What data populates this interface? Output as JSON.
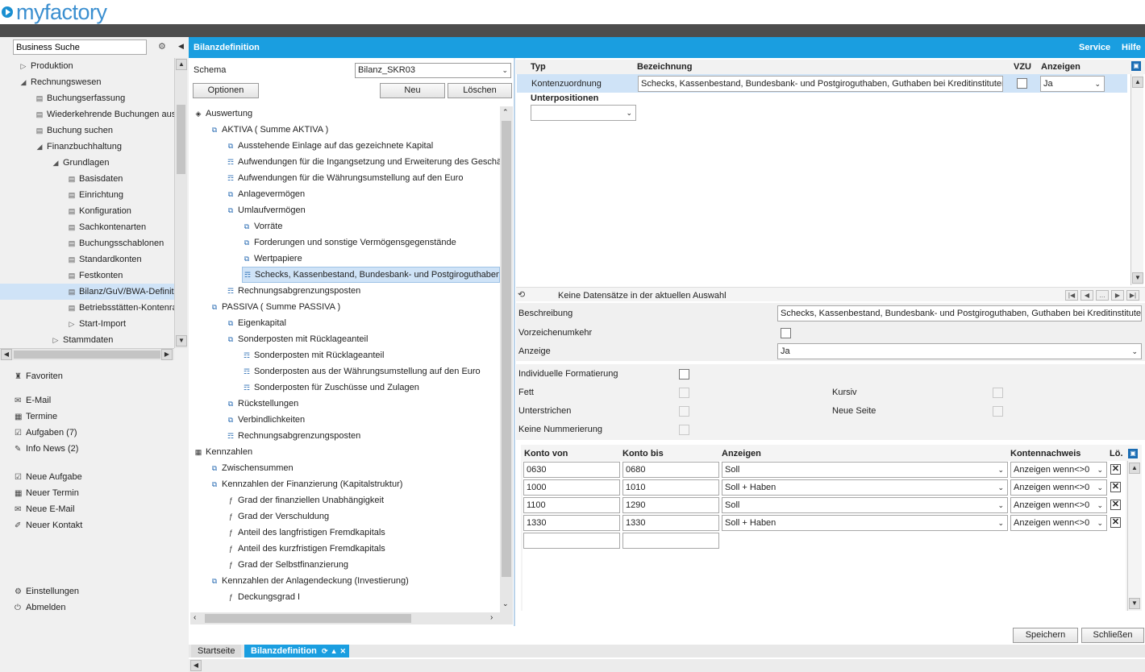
{
  "app": {
    "logo": "myfactory"
  },
  "sidebar": {
    "search_value": "Business Suche",
    "tree": [
      {
        "label": "Produktion",
        "icon": "expand-icon"
      },
      {
        "label": "Rechnungswesen",
        "icon": "collapse-icon"
      },
      {
        "label": "Buchungserfassung",
        "icon": "page-icon"
      },
      {
        "label": "Wiederkehrende Buchungen aus",
        "icon": "page-icon"
      },
      {
        "label": "Buchung suchen",
        "icon": "page-icon"
      },
      {
        "label": "Finanzbuchhaltung",
        "icon": "collapse-icon"
      },
      {
        "label": "Grundlagen",
        "icon": "collapse-icon"
      },
      {
        "label": "Basisdaten",
        "icon": "page-icon"
      },
      {
        "label": "Einrichtung",
        "icon": "page-icon"
      },
      {
        "label": "Konfiguration",
        "icon": "page-icon"
      },
      {
        "label": "Sachkontenarten",
        "icon": "page-icon"
      },
      {
        "label": "Buchungsschablonen",
        "icon": "page-icon"
      },
      {
        "label": "Standardkonten",
        "icon": "page-icon"
      },
      {
        "label": "Festkonten",
        "icon": "page-icon"
      },
      {
        "label": "Bilanz/GuV/BWA-Definit",
        "icon": "page-icon"
      },
      {
        "label": "Betriebsstätten-Kontenra",
        "icon": "page-icon"
      },
      {
        "label": "Start-Import",
        "icon": "expand-icon"
      },
      {
        "label": "Stammdaten",
        "icon": "expand-icon"
      }
    ],
    "favorites": "Favoriten",
    "links1": [
      "E-Mail",
      "Termine",
      "Aufgaben (7)",
      "Info News (2)"
    ],
    "links2": [
      "Neue Aufgabe",
      "Neuer Termin",
      "Neue E-Mail",
      "Neuer Kontakt"
    ],
    "settings": "Einstellungen",
    "logout": "Abmelden"
  },
  "header": {
    "title": "Bilanzdefinition",
    "service": "Service",
    "help": "Hilfe"
  },
  "schema": {
    "label": "Schema",
    "value": "Bilanz_SKR03",
    "options_button": "Optionen",
    "new_button": "Neu",
    "delete_button": "Löschen"
  },
  "tree": [
    {
      "label": "Auswertung",
      "level": 0,
      "icon": "diamond-icon"
    },
    {
      "label": "AKTIVA ( Summe AKTIVA )",
      "level": 1,
      "icon": "node-icon"
    },
    {
      "label": "Ausstehende Einlage auf das gezeichnete Kapital",
      "level": 2,
      "icon": "node-icon"
    },
    {
      "label": "Aufwendungen für die Ingangsetzung und Erweiterung des Geschä",
      "level": 2,
      "icon": "account-icon"
    },
    {
      "label": "Aufwendungen für die Währungsumstellung auf den Euro",
      "level": 2,
      "icon": "account-icon"
    },
    {
      "label": "Anlagevermögen",
      "level": 2,
      "icon": "node-icon"
    },
    {
      "label": "Umlaufvermögen",
      "level": 2,
      "icon": "node-icon"
    },
    {
      "label": "Vorräte",
      "level": 3,
      "icon": "node-icon"
    },
    {
      "label": "Forderungen und sonstige Vermögensgegenstände",
      "level": 3,
      "icon": "node-icon"
    },
    {
      "label": "Wertpapiere",
      "level": 3,
      "icon": "node-icon"
    },
    {
      "label": "Schecks, Kassenbestand, Bundesbank- und Postgiroguthaben,",
      "level": 3,
      "icon": "account-icon",
      "selected": true
    },
    {
      "label": "Rechnungsabgrenzungsposten",
      "level": 2,
      "icon": "account-icon"
    },
    {
      "label": "PASSIVA ( Summe PASSIVA )",
      "level": 1,
      "icon": "node-icon"
    },
    {
      "label": "Eigenkapital",
      "level": 2,
      "icon": "node-icon"
    },
    {
      "label": "Sonderposten mit Rücklageanteil",
      "level": 2,
      "icon": "node-icon"
    },
    {
      "label": "Sonderposten mit Rücklageanteil",
      "level": 3,
      "icon": "account-icon"
    },
    {
      "label": "Sonderposten aus der Währungsumstellung auf den Euro",
      "level": 3,
      "icon": "account-icon"
    },
    {
      "label": "Sonderposten für Zuschüsse und Zulagen",
      "level": 3,
      "icon": "account-icon"
    },
    {
      "label": "Rückstellungen",
      "level": 2,
      "icon": "node-icon"
    },
    {
      "label": "Verbindlichkeiten",
      "level": 2,
      "icon": "node-icon"
    },
    {
      "label": "Rechnungsabgrenzungsposten",
      "level": 2,
      "icon": "account-icon"
    },
    {
      "label": "Kennzahlen",
      "level": 0,
      "icon": "calculator-icon"
    },
    {
      "label": "Zwischensummen",
      "level": 1,
      "icon": "node-icon"
    },
    {
      "label": "Kennzahlen der Finanzierung (Kapitalstruktur)",
      "level": 1,
      "icon": "node-icon"
    },
    {
      "label": "Grad der finanziellen Unabhängigkeit",
      "level": 2,
      "icon": "formula-icon"
    },
    {
      "label": "Grad der Verschuldung",
      "level": 2,
      "icon": "formula-icon"
    },
    {
      "label": "Anteil des langfristigen Fremdkapitals",
      "level": 2,
      "icon": "formula-icon"
    },
    {
      "label": "Anteil des kurzfristigen Fremdkapitals",
      "level": 2,
      "icon": "formula-icon"
    },
    {
      "label": "Grad der Selbstfinanzierung",
      "level": 2,
      "icon": "formula-icon"
    },
    {
      "label": "Kennzahlen der Anlagendeckung (Investierung)",
      "level": 1,
      "icon": "node-icon"
    },
    {
      "label": "Deckungsgrad I",
      "level": 2,
      "icon": "formula-icon"
    }
  ],
  "grid": {
    "headers": {
      "typ": "Typ",
      "bezeichnung": "Bezeichnung",
      "vzu": "VZU",
      "anzeigen": "Anzeigen"
    },
    "row": {
      "typ": "Kontenzuordnung",
      "bezeichnung": "Schecks, Kassenbestand, Bundesbank- und Postgiroguthaben, Guthaben bei Kreditinstituten",
      "anzeigen": "Ja"
    },
    "subheader": "Unterpositionen",
    "sub_value": "",
    "status": "Keine Datensätze in der aktuellen Auswahl"
  },
  "form": {
    "beschreibung_label": "Beschreibung",
    "beschreibung_value": "Schecks, Kassenbestand, Bundesbank- und Postgiroguthaben, Guthaben bei Kreditinstituten",
    "vorzeichen_label": "Vorzeichenumkehr",
    "anzeige_label": "Anzeige",
    "anzeige_value": "Ja",
    "indiv_label": "Individuelle Formatierung",
    "fett_label": "Fett",
    "kursiv_label": "Kursiv",
    "unterstrichen_label": "Unterstrichen",
    "neue_seite_label": "Neue Seite",
    "keine_num_label": "Keine Nummerierung"
  },
  "konten": {
    "headers": {
      "von": "Konto von",
      "bis": "Konto bis",
      "anzeigen": "Anzeigen",
      "nachweis": "Kontennachweis",
      "loe": "Lö."
    },
    "rows": [
      {
        "von": "0630",
        "bis": "0680",
        "anzeigen": "Soll",
        "nachweis": "Anzeigen wenn<>0"
      },
      {
        "von": "1000",
        "bis": "1010",
        "anzeigen": "Soll + Haben",
        "nachweis": "Anzeigen wenn<>0"
      },
      {
        "von": "1100",
        "bis": "1290",
        "anzeigen": "Soll",
        "nachweis": "Anzeigen wenn<>0"
      },
      {
        "von": "1330",
        "bis": "1330",
        "anzeigen": "Soll + Haben",
        "nachweis": "Anzeigen wenn<>0"
      }
    ]
  },
  "footer": {
    "save_button": "Speichern",
    "close_button": "Schließen"
  },
  "tabs": [
    {
      "label": "Startseite"
    },
    {
      "label": "Bilanzdefinition"
    }
  ]
}
